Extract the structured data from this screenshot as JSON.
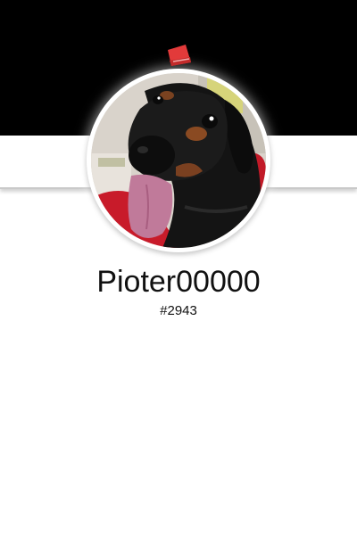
{
  "profile": {
    "username": "Pioter00000",
    "discriminator": "#2943",
    "avatar": "dachshund-photo"
  },
  "badge": {
    "icon": "red-hat-icon"
  },
  "colors": {
    "banner": "#000000",
    "background": "#ffffff",
    "text": "#111111"
  }
}
